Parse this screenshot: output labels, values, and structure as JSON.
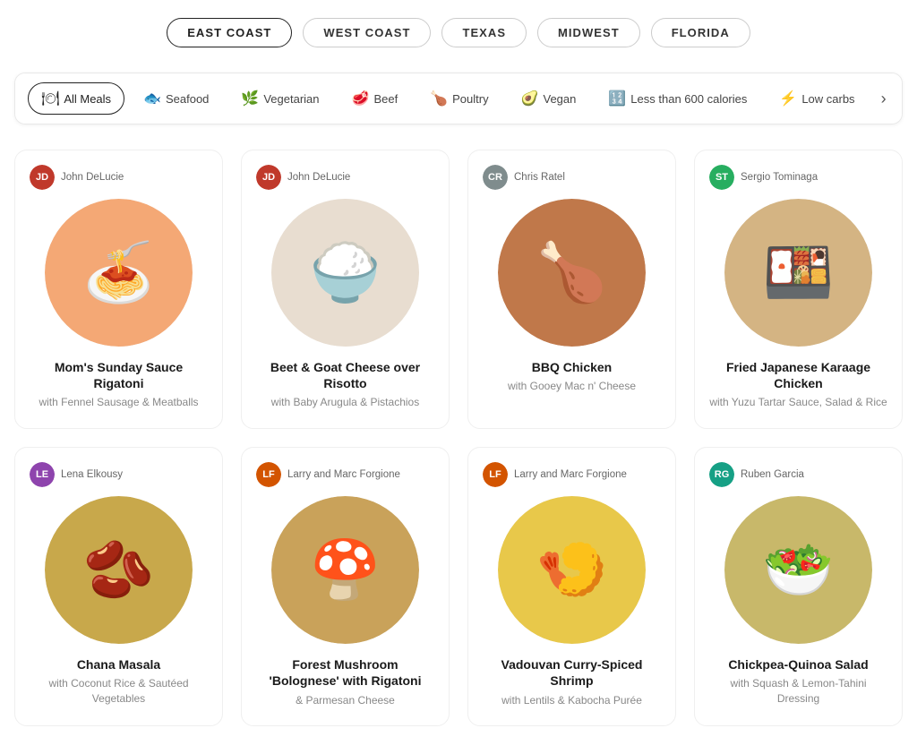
{
  "regions": [
    {
      "id": "east-coast",
      "label": "EAST COAST",
      "active": true
    },
    {
      "id": "west-coast",
      "label": "WEST COAST",
      "active": false
    },
    {
      "id": "texas",
      "label": "TEXAS",
      "active": false
    },
    {
      "id": "midwest",
      "label": "MIDWEST",
      "active": false
    },
    {
      "id": "florida",
      "label": "FLORIDA",
      "active": false
    }
  ],
  "categories": [
    {
      "id": "all-meals",
      "label": "All Meals",
      "icon": "🍽",
      "active": true
    },
    {
      "id": "seafood",
      "label": "Seafood",
      "icon": "🐟",
      "active": false
    },
    {
      "id": "vegetarian",
      "label": "Vegetarian",
      "icon": "🌿",
      "active": false
    },
    {
      "id": "beef",
      "label": "Beef",
      "icon": "🥩",
      "active": false
    },
    {
      "id": "poultry",
      "label": "Poultry",
      "icon": "🍗",
      "active": false
    },
    {
      "id": "vegan",
      "label": "Vegan",
      "icon": "🥑",
      "active": false
    },
    {
      "id": "low-cal",
      "label": "Less than 600 calories",
      "icon": "🔢",
      "active": false
    },
    {
      "id": "low-carbs",
      "label": "Low carbs",
      "icon": "⚡",
      "active": false
    }
  ],
  "meals": [
    {
      "id": "meal-1",
      "chef": "John DeLucie",
      "chef_color": "#c0392b",
      "chef_initials": "JD",
      "title": "Mom's Sunday Sauce Rigatoni",
      "subtitle": "with Fennel Sausage & Meatballs",
      "bg": "#f4a875",
      "emoji": "🍝"
    },
    {
      "id": "meal-2",
      "chef": "John DeLucie",
      "chef_color": "#c0392b",
      "chef_initials": "JD",
      "title": "Beet & Goat Cheese over Risotto",
      "subtitle": "with Baby Arugula & Pistachios",
      "bg": "#e8ddd0",
      "emoji": "🍚"
    },
    {
      "id": "meal-3",
      "chef": "Chris Ratel",
      "chef_color": "#7f8c8d",
      "chef_initials": "CR",
      "title": "BBQ Chicken",
      "subtitle": "with Gooey Mac n' Cheese",
      "bg": "#c0784a",
      "emoji": "🍗"
    },
    {
      "id": "meal-4",
      "chef": "Sergio Tominaga",
      "chef_color": "#27ae60",
      "chef_initials": "ST",
      "title": "Fried Japanese Karaage Chicken",
      "subtitle": "with Yuzu Tartar Sauce, Salad & Rice",
      "bg": "#d4b483",
      "emoji": "🍱"
    },
    {
      "id": "meal-5",
      "chef": "Lena Elkousy",
      "chef_color": "#8e44ad",
      "chef_initials": "LE",
      "title": "Chana Masala",
      "subtitle": "with Coconut Rice & Sautéed Vegetables",
      "bg": "#c8a84b",
      "emoji": "🫘"
    },
    {
      "id": "meal-6",
      "chef": "Larry and Marc Forgione",
      "chef_color": "#d35400",
      "chef_initials": "LF",
      "title": "Forest Mushroom 'Bolognese' with Rigatoni",
      "subtitle": "& Parmesan Cheese",
      "bg": "#c9a25a",
      "emoji": "🍄"
    },
    {
      "id": "meal-7",
      "chef": "Larry and Marc Forgione",
      "chef_color": "#d35400",
      "chef_initials": "LF",
      "title": "Vadouvan Curry-Spiced Shrimp",
      "subtitle": "with Lentils & Kabocha Purée",
      "bg": "#e8c84a",
      "emoji": "🍤"
    },
    {
      "id": "meal-8",
      "chef": "Ruben Garcia",
      "chef_color": "#16a085",
      "chef_initials": "RG",
      "title": "Chickpea-Quinoa Salad",
      "subtitle": "with Squash & Lemon-Tahini Dressing",
      "bg": "#c8b86a",
      "emoji": "🥗"
    }
  ],
  "ui": {
    "chevron_label": "›"
  }
}
